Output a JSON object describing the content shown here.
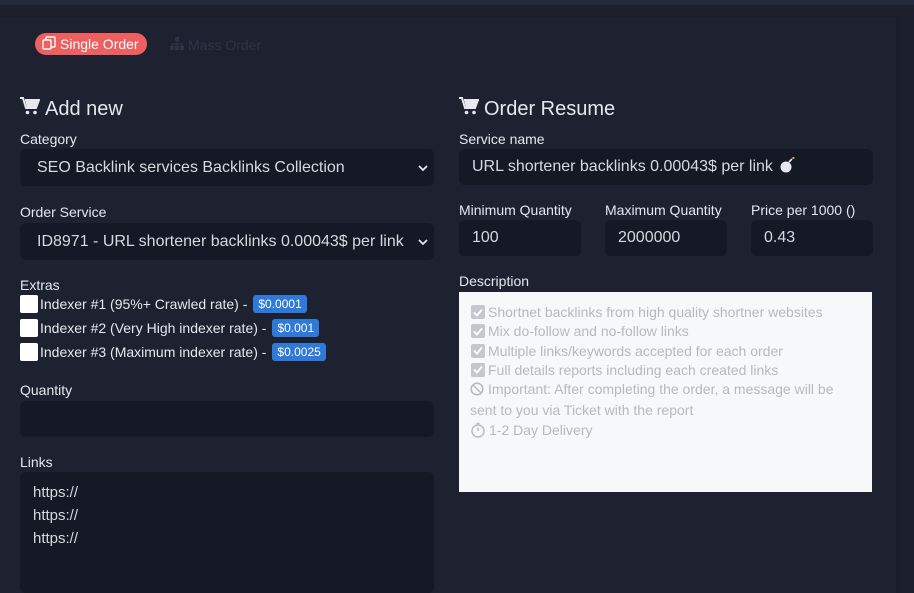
{
  "tabs": {
    "single_label": "Single Order",
    "mass_label": "Mass Order"
  },
  "add_new": {
    "title": "Add new",
    "category_label": "Category",
    "category_value": "SEO Backlink services Backlinks Collection",
    "service_label": "Order Service",
    "service_value": "ID8971 - URL shortener backlinks 0.00043$ per link",
    "extras_label": "Extras",
    "extras": [
      {
        "label": "Indexer #1 (95%+ Crawled rate) -",
        "price": "$0.0001"
      },
      {
        "label": "Indexer #2 (Very High indexer rate) -",
        "price": "$0.001"
      },
      {
        "label": "Indexer #3 (Maximum indexer rate) -",
        "price": "$0.0025"
      }
    ],
    "quantity_label": "Quantity",
    "links_label": "Links",
    "links_value": "https://\nhttps://\nhttps://"
  },
  "resume": {
    "title": "Order Resume",
    "service_name_label": "Service name",
    "service_name_value": "URL shortener backlinks 0.00043$ per link",
    "min_label": "Minimum Quantity",
    "min_value": "100",
    "max_label": "Maximum Quantity",
    "max_value": "2000000",
    "price_label": "Price per 1000 ()",
    "price_value": "0.43",
    "description_label": "Description",
    "description": {
      "features": [
        "Shortnet backlinks from high quality shortner websites",
        "Mix do-follow and no-follow links",
        "Multiple links/keywords accepted for each order",
        "Full details reports including each created links"
      ],
      "important": "Important: After completing the order, a message will be sent to you via Ticket with the report",
      "delivery": "1-2 Day Delivery"
    }
  },
  "colors": {
    "accent": "#ef5f5f",
    "badge": "#2f7ad9",
    "bg": "#1d2130",
    "field": "#151925"
  }
}
